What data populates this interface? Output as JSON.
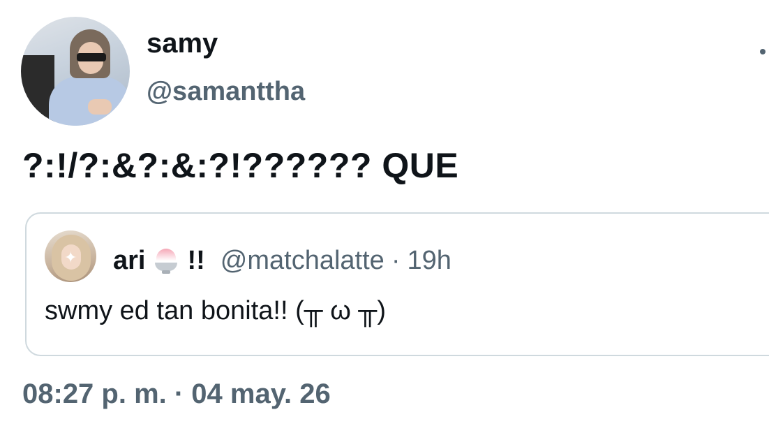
{
  "author": {
    "display_name": "samy",
    "handle": "@samanttha",
    "avatar_icon": "profile-photo"
  },
  "tweet": {
    "text": "?:!/?:&?:&:?!?????? QUE",
    "timestamp": "08:27 p. m. · 04 may. 26"
  },
  "quoted_tweet": {
    "display_name": "ari",
    "name_emoji_icon": "shaved-ice-icon",
    "name_suffix": "!!",
    "handle": "@matchalatte",
    "separator": "·",
    "relative_time": "19h",
    "text": "swmy ed tan bonita!! (╥ ω ╥)",
    "avatar_icon": "profile-photo"
  },
  "colors": {
    "primary_text": "#0f1419",
    "secondary_text": "#536471",
    "border": "#cfd9de",
    "background": "#ffffff"
  }
}
